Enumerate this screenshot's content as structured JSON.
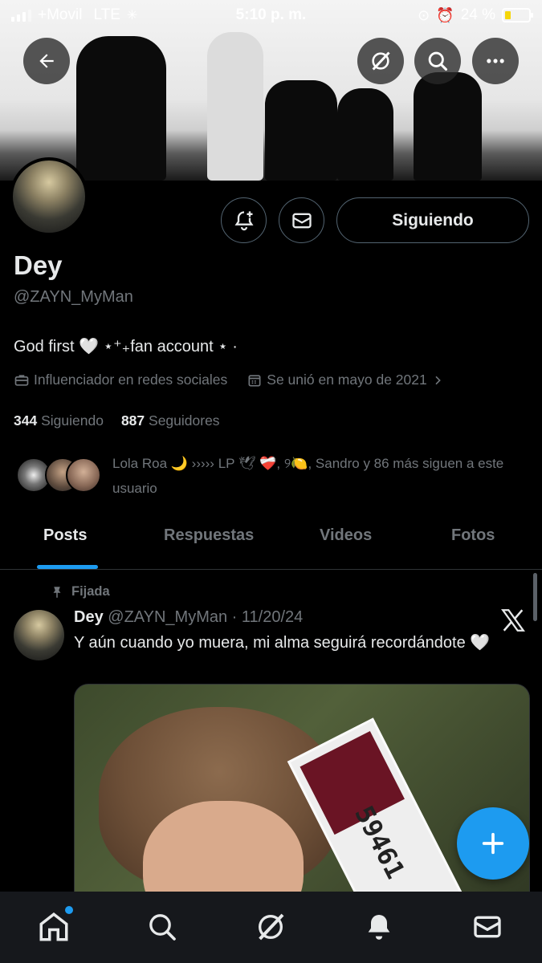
{
  "status_bar": {
    "carrier": "+Movil",
    "network": "LTE",
    "time": "5:10 p. m.",
    "battery_percent": "24 %",
    "battery_level": 0.24
  },
  "header": {
    "back_icon": "arrow-left-icon",
    "grok_icon": "grok-icon",
    "search_icon": "search-icon",
    "more_icon": "more-horizontal-icon"
  },
  "profile": {
    "name": "Dey",
    "handle": "@ZAYN_MyMan",
    "bio": "God first 🤍 ⋆⁺₊fan account ⋆ ·",
    "category": "Influenciador en redes sociales",
    "joined": "Se unió en mayo de 2021",
    "following_count": "344",
    "following_label": "Siguiendo",
    "followers_count": "887",
    "followers_label": "Seguidores",
    "follow_button": "Siguiendo",
    "followed_by": "Lola Roa 🌙 ››››› LP 🕊 ❤️‍🩹, ୨🍋, Sandro y 86 más siguen a este usuario"
  },
  "tabs": [
    {
      "label": "Posts",
      "active": true
    },
    {
      "label": "Respuestas",
      "active": false
    },
    {
      "label": "Videos",
      "active": false
    },
    {
      "label": "Fotos",
      "active": false
    }
  ],
  "post": {
    "pinned_label": "Fijada",
    "author": "Dey",
    "handle_date": "@ZAYN_MyMan · 11/20/24",
    "text": "Y aún cuando yo muera, mi alma seguirá recordándote 🤍",
    "media_card_number": "59461"
  },
  "bottom_nav": [
    "home-icon",
    "search-icon",
    "grok-icon",
    "notifications-icon",
    "messages-icon"
  ],
  "colors": {
    "accent": "#1d9bf0",
    "background": "#000000",
    "secondary_text": "#71767b"
  }
}
